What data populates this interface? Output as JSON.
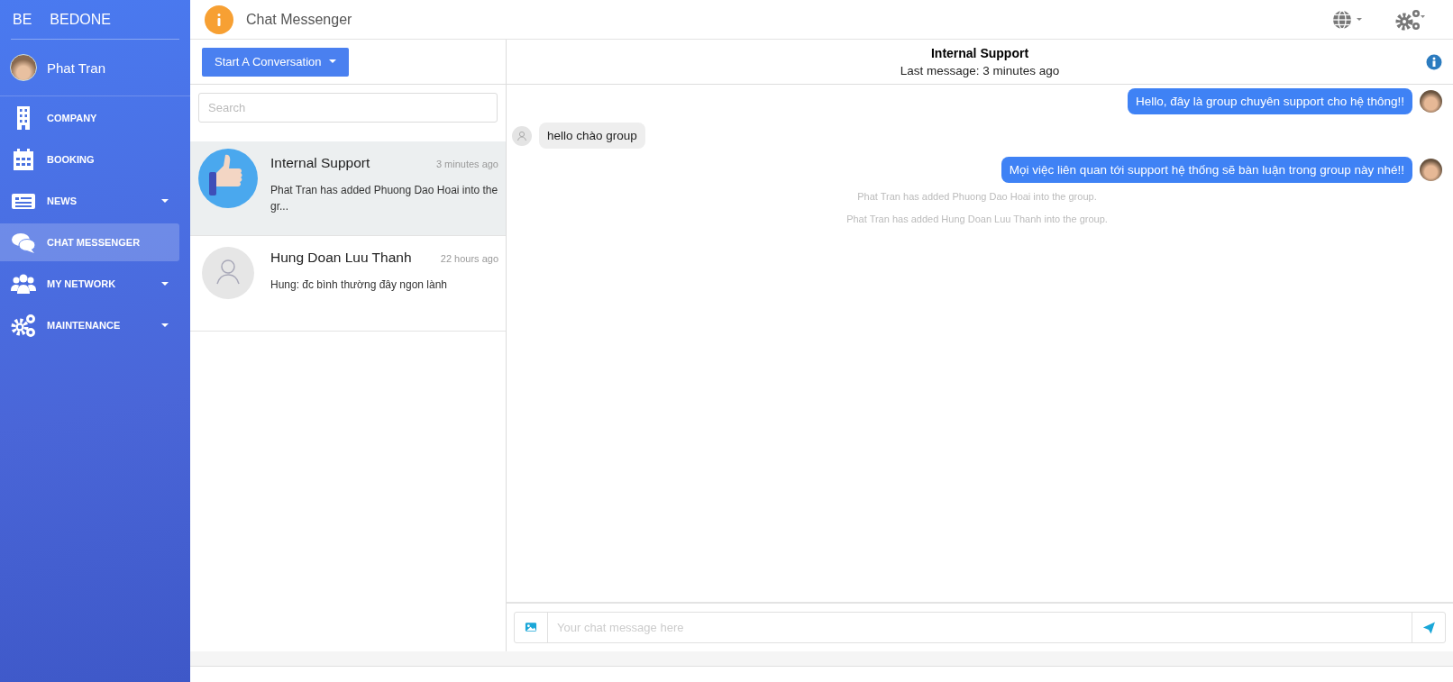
{
  "brand": {
    "left": "BE",
    "right": "BEDONE"
  },
  "user": {
    "name": "Phat Tran"
  },
  "sidebar": {
    "items": [
      {
        "label": "COMPANY",
        "expandable": false,
        "selected": false
      },
      {
        "label": "BOOKING",
        "expandable": false,
        "selected": false
      },
      {
        "label": "NEWS",
        "expandable": true,
        "selected": false
      },
      {
        "label": "CHAT MESSENGER",
        "expandable": false,
        "selected": true
      },
      {
        "label": "MY NETWORK",
        "expandable": true,
        "selected": false
      },
      {
        "label": "MAINTENANCE",
        "expandable": true,
        "selected": false
      }
    ]
  },
  "topbar": {
    "title": "Chat Messenger"
  },
  "conversations": {
    "start_button": "Start A Conversation",
    "search": {
      "placeholder": "Search"
    },
    "items": [
      {
        "kind": "group",
        "name": "Internal Support",
        "time": "3 minutes ago",
        "preview": "Phat Tran has added Phuong Dao Hoai into the gr...",
        "selected": true
      },
      {
        "kind": "person",
        "name": "Hung Doan Luu Thanh",
        "time": "22 hours ago",
        "preview": "Hung: đc bình thường đây ngon lành",
        "selected": false
      }
    ]
  },
  "chat": {
    "title": "Internal Support",
    "subtitle": "Last message: 3 minutes ago",
    "messages": [
      {
        "kind": "outgoing",
        "text": "Hello, đây là group chuyên support cho hệ thông!!"
      },
      {
        "kind": "incoming",
        "text": "hello chào group"
      },
      {
        "kind": "outgoing",
        "text": "Mọi việc liên quan tới support hệ thống sẽ bàn luận trong group này nhé!!"
      },
      {
        "kind": "system",
        "text": "Phat Tran has added Phuong Dao Hoai into the group."
      },
      {
        "kind": "system",
        "text": "Phat Tran has added Hung Doan Luu Thanh into the group."
      }
    ],
    "input": {
      "placeholder": "Your chat message here"
    }
  }
}
